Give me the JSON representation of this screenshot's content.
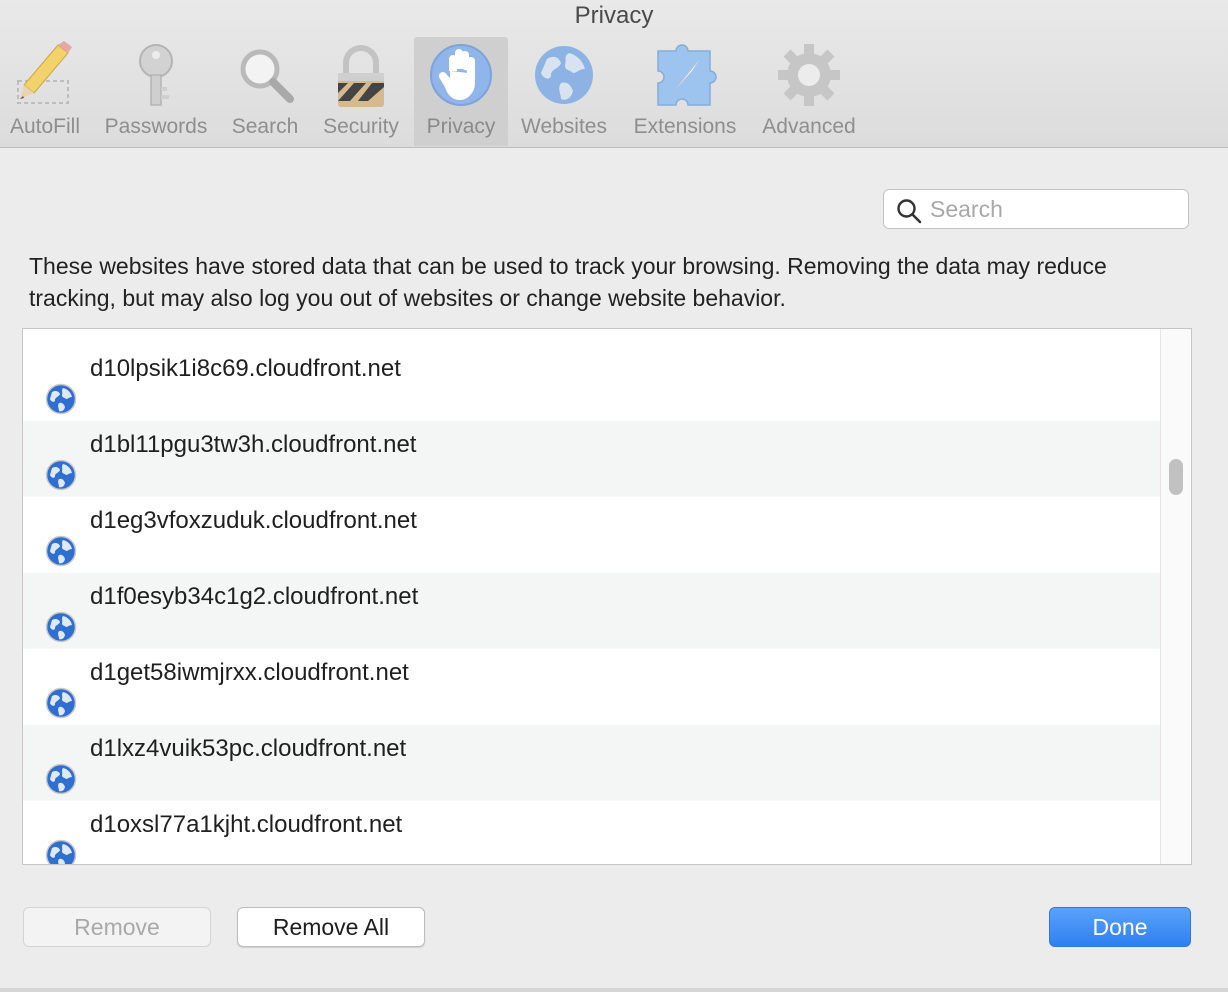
{
  "window": {
    "title": "Privacy"
  },
  "toolbar": {
    "tabs": [
      {
        "label": "AutoFill",
        "icon": "pencil-icon"
      },
      {
        "label": "Passwords",
        "icon": "key-icon"
      },
      {
        "label": "Search",
        "icon": "magnifier-icon"
      },
      {
        "label": "Security",
        "icon": "padlock-icon"
      },
      {
        "label": "Privacy",
        "icon": "hand-icon",
        "selected": true
      },
      {
        "label": "Websites",
        "icon": "globe-icon"
      },
      {
        "label": "Extensions",
        "icon": "puzzle-compass-icon"
      },
      {
        "label": "Advanced",
        "icon": "gear-icon"
      }
    ]
  },
  "search": {
    "placeholder": "Search",
    "value": ""
  },
  "description": "These websites have stored data that can be used to track your browsing. Removing the data may reduce tracking, but may also log you out of websites or change website behavior.",
  "websites": [
    "d10lpsik1i8c69.cloudfront.net",
    "d1bl11pgu3tw3h.cloudfront.net",
    "d1eg3vfoxzuduk.cloudfront.net",
    "d1f0esyb34c1g2.cloudfront.net",
    "d1get58iwmjrxx.cloudfront.net",
    "d1lxz4vuik53pc.cloudfront.net",
    "d1oxsl77a1kjht.cloudfront.net"
  ],
  "buttons": {
    "remove": "Remove",
    "remove_all": "Remove All",
    "done": "Done"
  },
  "colors": {
    "accent": "#2f7ff1",
    "selected_tab": "#cfcfcf"
  }
}
